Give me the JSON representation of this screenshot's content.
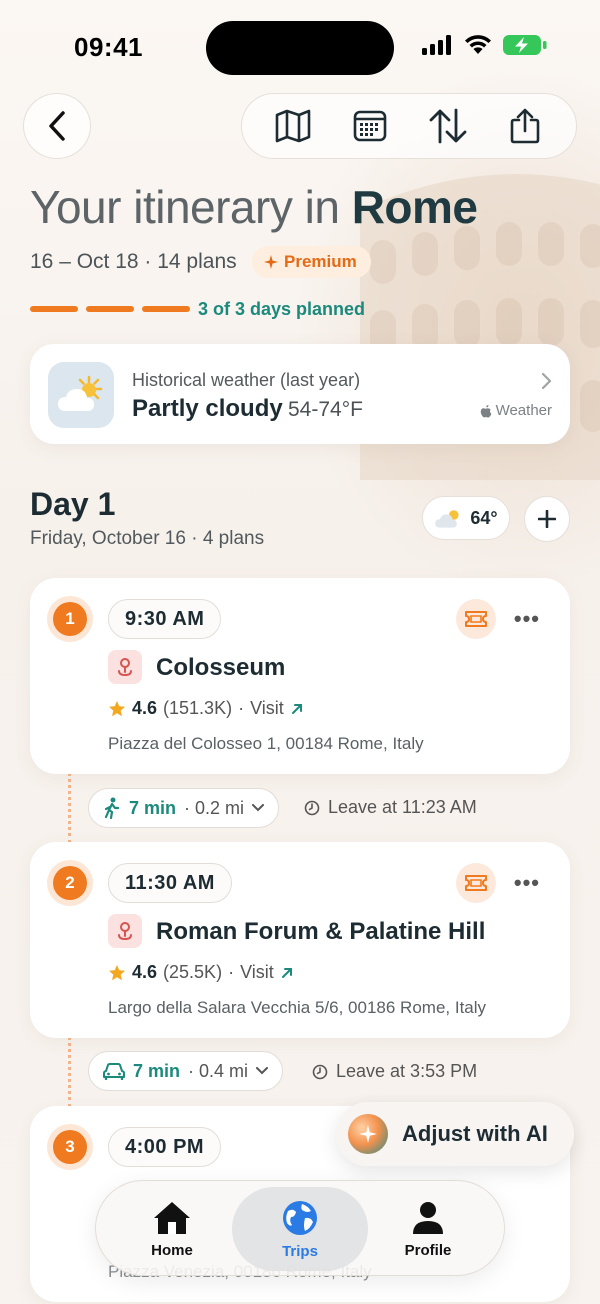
{
  "status": {
    "time": "09:41"
  },
  "header": {
    "title_prefix": "Your itinerary in ",
    "title_city": "Rome",
    "subtitle": "16 – Oct 18 · 14 plans",
    "badge": "Premium",
    "progress_text": "3 of 3 days planned",
    "progress": {
      "completed": 3,
      "total": 3
    },
    "toolbar_icons": [
      "map-icon",
      "calendar-icon",
      "sort-icon",
      "share-icon"
    ]
  },
  "weather": {
    "label": "Historical weather (last year)",
    "condition": "Partly cloudy",
    "temp_range": "54-74°F",
    "source": "Weather"
  },
  "day": {
    "title": "Day 1",
    "subtitle": "Friday, October 16 · 4 plans",
    "temp": "64°"
  },
  "plans": [
    {
      "number": "1",
      "time": "9:30 AM",
      "name": "Colosseum",
      "rating": "4.6",
      "reviews": "(151.3K)",
      "action": "Visit",
      "address": "Piazza del Colosseo 1, 00184 Rome, Italy"
    },
    {
      "number": "2",
      "time": "11:30 AM",
      "name": "Roman Forum & Palatine Hill",
      "rating": "4.6",
      "reviews": "(25.5K)",
      "action": "Visit",
      "address": "Largo della Salara Vecchia 5/6, 00186 Rome, Italy"
    },
    {
      "number": "3",
      "time": "4:00 PM",
      "address": "Piazza Venezia, 00186 Rome, Italy"
    }
  ],
  "transits": [
    {
      "mode": "walk",
      "duration": "7 min",
      "distance": "· 0.2 mi",
      "leave": "Leave at 11:23 AM"
    },
    {
      "mode": "car",
      "duration": "7 min",
      "distance": "· 0.4 mi",
      "leave": "Leave at 3:53 PM"
    }
  ],
  "ai_button": {
    "label": "Adjust with AI"
  },
  "tabs": [
    {
      "label": "Home",
      "icon": "home-icon"
    },
    {
      "label": "Trips",
      "icon": "globe-icon",
      "active": true
    },
    {
      "label": "Profile",
      "icon": "person-icon"
    }
  ],
  "colors": {
    "accent": "#f07a1f",
    "teal": "#1b8a7c",
    "active_tab": "#2b7be4"
  }
}
